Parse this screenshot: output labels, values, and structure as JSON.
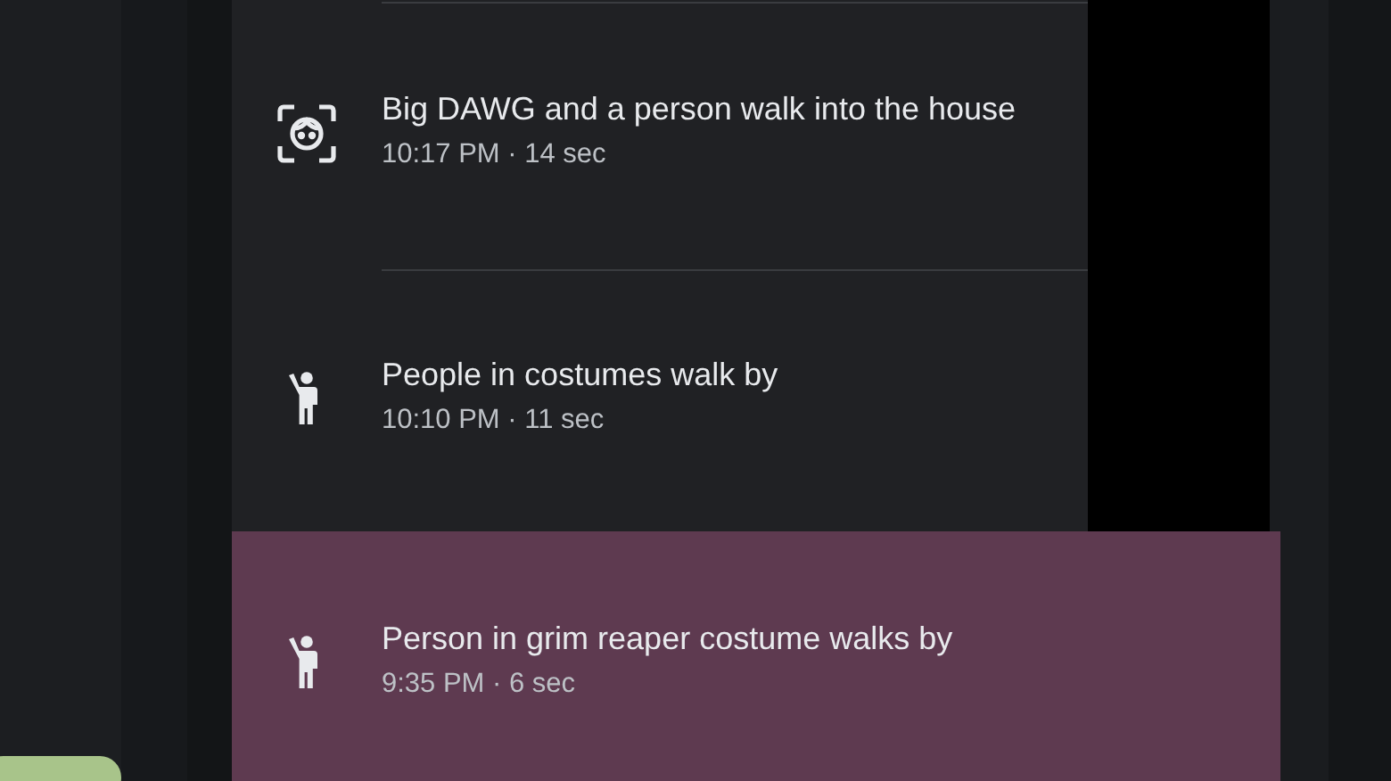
{
  "events": [
    {
      "kind": "face",
      "title": "Big DAWG and a person walk into the house",
      "time": "10:17 PM · 14 sec",
      "selected": false
    },
    {
      "kind": "person",
      "title": "People in costumes walk by",
      "time": "10:10 PM · 11 sec",
      "selected": false
    },
    {
      "kind": "person",
      "title": "Person in grim reaper costume walks by",
      "time": "9:35 PM · 6 sec",
      "selected": true
    }
  ]
}
